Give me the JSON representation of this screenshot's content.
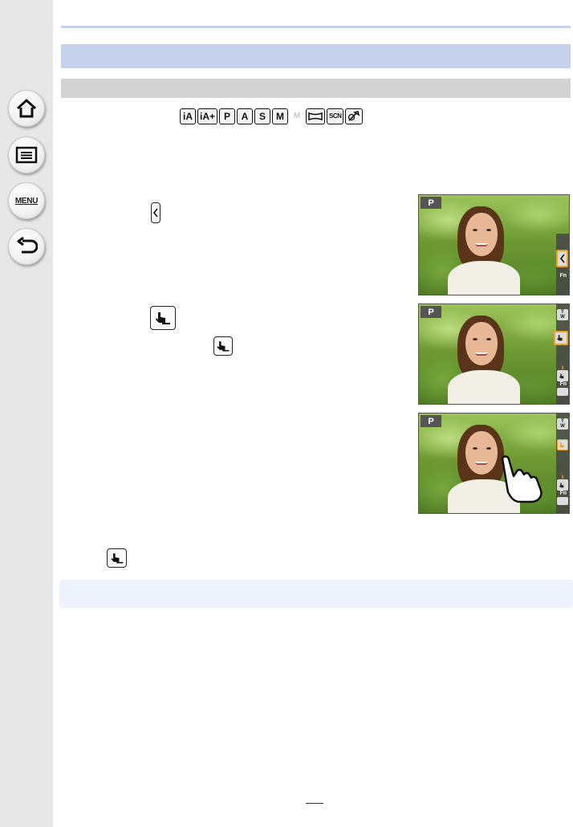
{
  "nav": {
    "home_icon": "home-icon",
    "contents_icon": "list-icon",
    "menu_label": "MENU",
    "back_icon": "back-arrow-icon"
  },
  "modes": {
    "items": [
      "iA",
      "iA+",
      "P",
      "A",
      "S",
      "M",
      "M",
      "",
      "SCN",
      ""
    ],
    "icons": [
      "intelligent-auto-icon",
      "intelligent-auto-plus-icon",
      "program-icon",
      "aperture-priority-icon",
      "shutter-priority-icon",
      "manual-icon",
      "creative-video-icon",
      "panorama-icon",
      "scene-guide-icon",
      "creative-control-icon"
    ]
  },
  "screens": {
    "mode_badge": "P",
    "fn_label": "Fn",
    "tele_top": "T",
    "tele_bottom": "W"
  },
  "colors": {
    "section_bar": "#c6d1ec",
    "subsection_bar": "#d3d3d3",
    "highlight": "#f0a020"
  }
}
